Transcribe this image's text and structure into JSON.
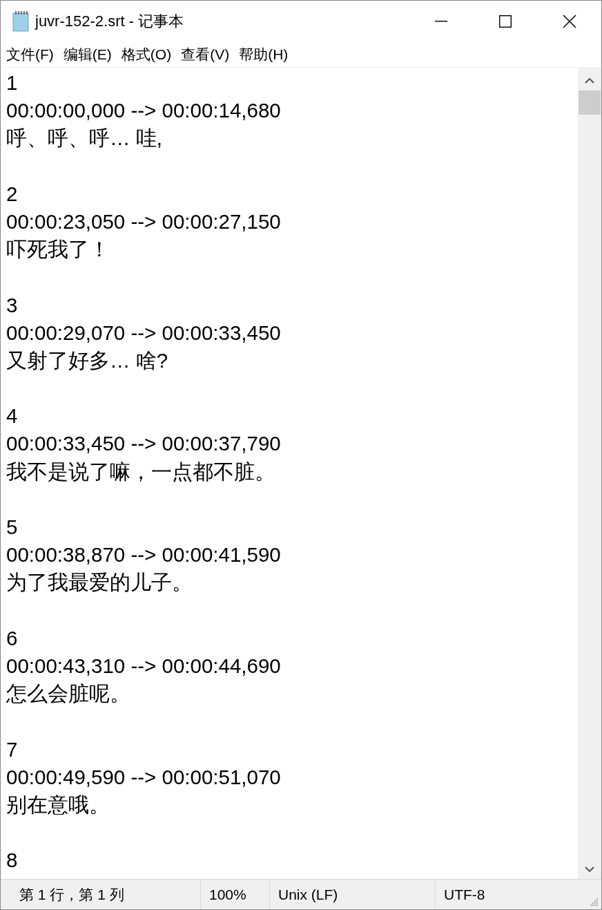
{
  "window": {
    "title": "juvr-152-2.srt - 记事本"
  },
  "menu": [
    {
      "label": "文件(F)"
    },
    {
      "label": "编辑(E)"
    },
    {
      "label": "格式(O)"
    },
    {
      "label": "查看(V)"
    },
    {
      "label": "帮助(H)"
    }
  ],
  "editor": {
    "entries": [
      {
        "index": "1",
        "timing": "00:00:00,000 --> 00:00:14,680",
        "text": "呼、呼、呼… 哇,"
      },
      {
        "index": "2",
        "timing": "00:00:23,050 --> 00:00:27,150",
        "text": "吓死我了！"
      },
      {
        "index": "3",
        "timing": "00:00:29,070 --> 00:00:33,450",
        "text": "又射了好多… 啥?"
      },
      {
        "index": "4",
        "timing": "00:00:33,450 --> 00:00:37,790",
        "text": "我不是说了嘛，一点都不脏。"
      },
      {
        "index": "5",
        "timing": "00:00:38,870 --> 00:00:41,590",
        "text": "为了我最爱的儿子。"
      },
      {
        "index": "6",
        "timing": "00:00:43,310 --> 00:00:44,690",
        "text": "怎么会脏呢。"
      },
      {
        "index": "7",
        "timing": "00:00:49,590 --> 00:00:51,070",
        "text": "别在意哦。"
      },
      {
        "index": "8"
      }
    ]
  },
  "status_bar": {
    "position": "第 1 行，第 1 列",
    "zoom": "100%",
    "line_ending": "Unix (LF)",
    "encoding": "UTF-8"
  }
}
